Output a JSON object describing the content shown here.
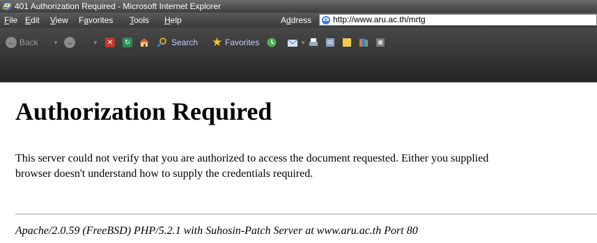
{
  "window": {
    "title": "401 Authorization Required - Microsoft Internet Explorer"
  },
  "menu": [
    {
      "accel": "F",
      "rest": "ile"
    },
    {
      "accel": "E",
      "rest": "dit"
    },
    {
      "accel": "V",
      "rest": "iew"
    },
    {
      "pre": "F",
      "accel": "a",
      "rest": "vorites"
    },
    {
      "accel": "T",
      "rest": "ools"
    },
    {
      "accel": "H",
      "rest": "elp"
    }
  ],
  "address": {
    "pre": "A",
    "accel": "d",
    "rest": "dress",
    "url": "http://www.aru.ac.th/mrtg"
  },
  "toolbar": {
    "back": "Back",
    "search": "Search",
    "favorites": "Favorites"
  },
  "page": {
    "heading": "Authorization Required",
    "para_line1": "This server could not verify that you are authorized to access the document requested. Either you supplied",
    "para_line2": "browser doesn't understand how to supply the credentials required.",
    "server_address": "Apache/2.0.59 (FreeBSD) PHP/5.2.1 with Suhosin-Patch Server at www.aru.ac.th Port 80"
  }
}
